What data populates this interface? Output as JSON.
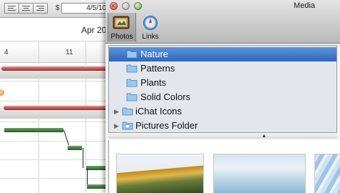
{
  "gantt": {
    "date_prefix": "$",
    "date_field_value": "4/5/10",
    "period_label": "Apr 20",
    "day_labels": [
      "4",
      "11"
    ]
  },
  "media_window": {
    "title": "Media",
    "toolbar": {
      "photos_label": "Photos",
      "links_label": "Links"
    },
    "sources": [
      {
        "label": "Nature",
        "selected": true,
        "disclosure": false
      },
      {
        "label": "Patterns",
        "selected": false,
        "disclosure": false
      },
      {
        "label": "Plants",
        "selected": false,
        "disclosure": false
      },
      {
        "label": "Solid Colors",
        "selected": false,
        "disclosure": false
      },
      {
        "label": "iChat Icons",
        "selected": false,
        "disclosure": true
      },
      {
        "label": "Pictures Folder",
        "selected": false,
        "disclosure": true
      }
    ],
    "thumbnails": [
      "pagoda-photo",
      "sky-lake-photo",
      "ice-photo"
    ],
    "colors": {
      "selection": "#3a79cc",
      "source_list_bg": "#e3e7ec",
      "red_bar": "#a92727",
      "green_bar": "#2e6e2e"
    }
  }
}
